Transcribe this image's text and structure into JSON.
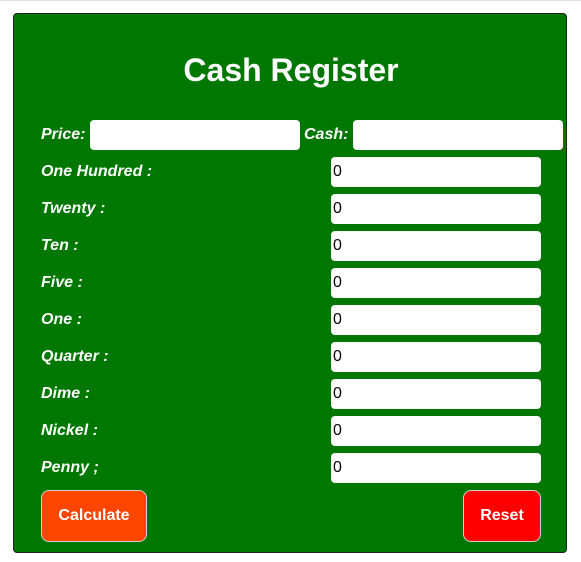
{
  "title": "Cash Register",
  "price": {
    "label": "Price:",
    "value": ""
  },
  "cash": {
    "label": "Cash:",
    "value": ""
  },
  "denominations": [
    {
      "label": "One Hundred :",
      "value": "0"
    },
    {
      "label": "Twenty :",
      "value": "0"
    },
    {
      "label": "Ten :",
      "value": "0"
    },
    {
      "label": "Five :",
      "value": "0"
    },
    {
      "label": "One :",
      "value": "0"
    },
    {
      "label": "Quarter :",
      "value": "0"
    },
    {
      "label": "Dime :",
      "value": "0"
    },
    {
      "label": "Nickel :",
      "value": "0"
    },
    {
      "label": "Penny ;",
      "value": "0"
    }
  ],
  "buttons": {
    "calculate": "Calculate",
    "reset": "Reset"
  },
  "colors": {
    "panel": "#007700",
    "calculate": "#ff4500",
    "reset": "#ff0000",
    "text": "#ffffff"
  }
}
